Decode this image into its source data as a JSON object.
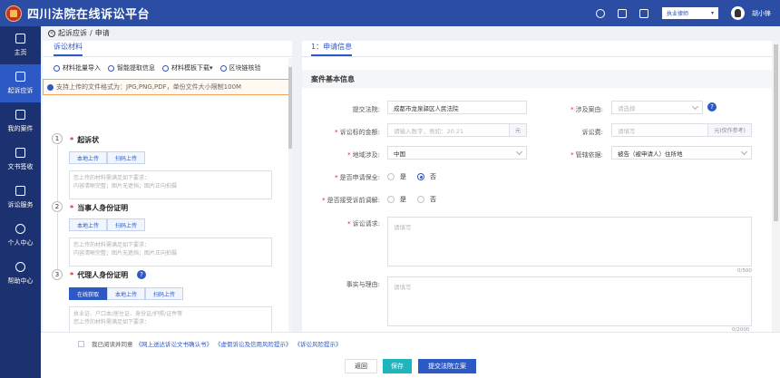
{
  "app": {
    "title": "四川法院在线诉讼平台",
    "role": "执业律师",
    "username": "胡小锋"
  },
  "sidebar": {
    "items": [
      {
        "label": "主页"
      },
      {
        "label": "起诉应诉",
        "active": true
      },
      {
        "label": "我的案件"
      },
      {
        "label": "文书签收"
      },
      {
        "label": "诉讼服务"
      },
      {
        "label": "个人中心"
      },
      {
        "label": "帮助中心"
      }
    ]
  },
  "breadcrumb": {
    "parent": "起诉应诉",
    "sep": "/",
    "current": "申请"
  },
  "left": {
    "tab": "诉讼材料",
    "tools": [
      "材料批量导入",
      "智能提取信息",
      "材料模板下载",
      "区块链核验"
    ],
    "notice": "支持上传的文件格式为：JPG,PNG,PDF，单份文件大小限制100M",
    "steps": [
      {
        "num": "1",
        "title": "起诉状",
        "buttons": [
          "本地上传",
          "扫码上传"
        ],
        "drop": [
          "您上传的材料需满足如下要求：",
          "内容清晰完整；图片无遮挡；图片正向拍摄"
        ]
      },
      {
        "num": "2",
        "title": "当事人身份证明",
        "buttons": [
          "本地上传",
          "扫码上传"
        ],
        "drop": [
          "您上传的材料需满足如下要求：",
          "内容清晰完整；图片无遮挡；图片正向拍摄"
        ]
      },
      {
        "num": "3",
        "title": "代理人身份证明",
        "buttons": [
          "在线获取",
          "本地上传",
          "扫码上传"
        ],
        "drop": [
          "执业证、户口本/居住证、身份证/护照/证件等",
          "您上传的材料需满足如下要求："
        ]
      }
    ]
  },
  "right": {
    "tab": "1：申请信息",
    "section": "案件基本信息",
    "court": {
      "label": "提交法院:",
      "value": "成都市龙泉驿区人民法院"
    },
    "cause": {
      "label": "涉及案由:",
      "placeholder": "请选择"
    },
    "amount": {
      "label": "诉讼标的金额:",
      "placeholder": "请输入数字，例如：20.21",
      "suffix": "元"
    },
    "fee": {
      "label": "诉讼费:",
      "placeholder": "请填写",
      "suffix": "元(仅作参考)"
    },
    "region": {
      "label": "地域涉及:",
      "value": "中国"
    },
    "jurisdiction": {
      "label": "管辖依据:",
      "value": "被告（被申请人）住所地"
    },
    "preservation": {
      "label": "是否申请保全:",
      "options": [
        "是",
        "否"
      ],
      "selected": "否"
    },
    "mediation": {
      "label": "是否接受诉前调解:",
      "options": [
        "是",
        "否"
      ]
    },
    "claims": {
      "label": "诉讼请求:",
      "placeholder": "请填写",
      "counter": "0/500"
    },
    "facts": {
      "label": "事实与理由:",
      "placeholder": "请填写",
      "counter": "0/2000"
    }
  },
  "footer": {
    "agree_text": "我已阅读并同意",
    "links": [
      "《网上送达诉讼文书确认书》",
      "《虚假诉讼及信用风险提示》",
      "《诉讼风险提示》"
    ],
    "back": "返回",
    "save": "保存",
    "submit": "提交法院立案"
  }
}
